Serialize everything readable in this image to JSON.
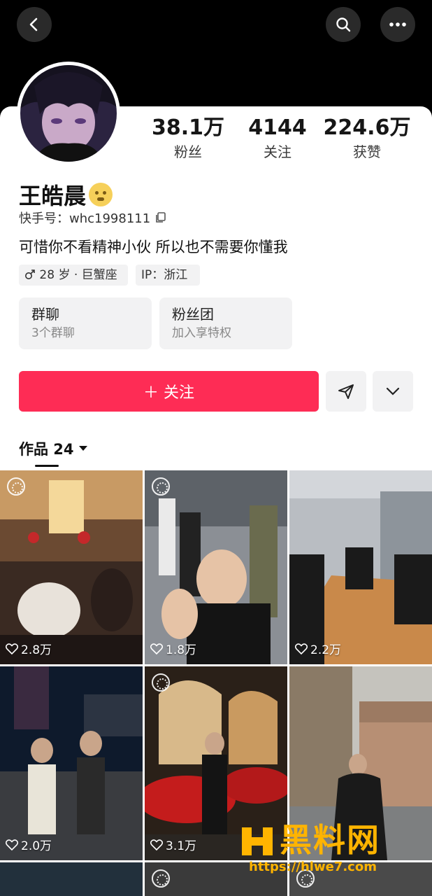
{
  "stats": [
    {
      "value": "38.1万",
      "label": "粉丝"
    },
    {
      "value": "4144",
      "label": "关注"
    },
    {
      "value": "224.6万",
      "label": "获赞"
    }
  ],
  "profile": {
    "name": "王皓晨",
    "uid_label": "快手号：whc1998111",
    "bio": "可惜你不看精神小伙 所以也不需要你懂我",
    "tag_age": "28 岁 · 巨蟹座",
    "tag_ip": "IP：浙江"
  },
  "cards": [
    {
      "title": "群聊",
      "sub": "3个群聊"
    },
    {
      "title": "粉丝团",
      "sub": "加入享特权"
    }
  ],
  "actions": {
    "follow_label": "＋ 关注"
  },
  "tabs": {
    "works_label": "作品 24"
  },
  "tiles": [
    {
      "likes": "2.8万"
    },
    {
      "likes": "1.8万"
    },
    {
      "likes": "2.2万"
    },
    {
      "likes": "2.0万"
    },
    {
      "likes": "3.1万"
    }
  ],
  "watermark": {
    "text": "黑料网",
    "url": "https://hlwe7.com"
  },
  "colors": {
    "accent": "#fe2c55",
    "watermark": "#ffb400"
  }
}
